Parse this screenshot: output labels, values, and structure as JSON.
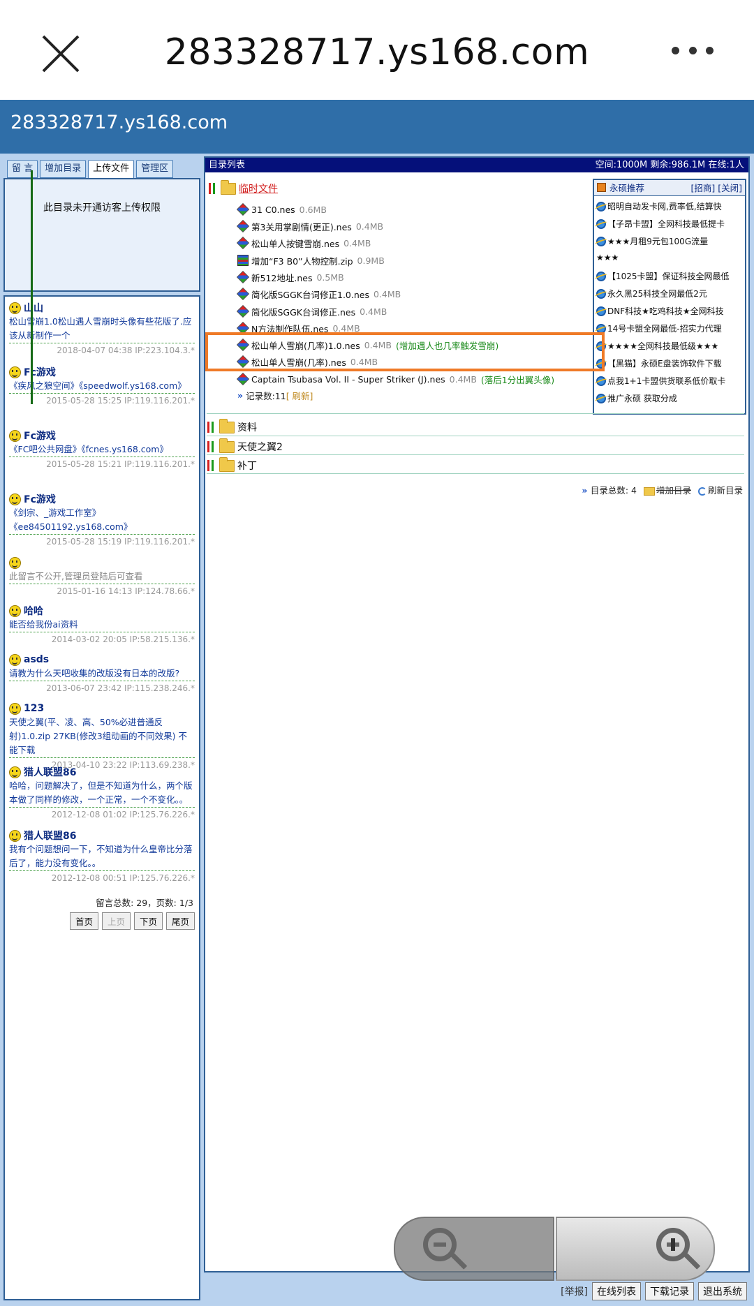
{
  "browser": {
    "title": "283328717.ys168.com"
  },
  "site": {
    "title": "283328717.ys168.com"
  },
  "tabs": [
    {
      "label": "留 言"
    },
    {
      "label": "增加目录"
    },
    {
      "label": "上传文件"
    },
    {
      "label": "管理区"
    }
  ],
  "upload_message": "此目录未开通访客上传权限",
  "comments": [
    {
      "name": "山山",
      "body": "松山雪崩1.0松山遇人雪崩时头像有些花版了.应该从新制作一个",
      "meta": "2018-04-07 04:38 IP:223.104.3.*"
    },
    {
      "name": "Fc游戏",
      "body": "《疾风之狼空间》《speedwolf.ys168.com》",
      "meta": "2015-05-28 15:25 IP:119.116.201.*"
    },
    {
      "name": "Fc游戏",
      "body": "《FC吧公共网盘》《fcnes.ys168.com》",
      "meta": "2015-05-28 15:21 IP:119.116.201.*"
    },
    {
      "name": "Fc游戏",
      "body": "《剑宗、_游戏工作室》《ee84501192.ys168.com》",
      "meta": "2015-05-28 15:19 IP:119.116.201.*"
    },
    {
      "name": "",
      "body": "此留言不公开,管理员登陆后可查看",
      "meta": "2015-01-16 14:13 IP:124.78.66.*"
    },
    {
      "name": "哈哈",
      "body": "能否给我份ai资料",
      "meta": "2014-03-02 20:05 IP:58.215.136.*"
    },
    {
      "name": "asds",
      "body": "请教为什么天吧收集的改版没有日本的改版?",
      "meta": "2013-06-07 23:42 IP:115.238.246.*"
    },
    {
      "name": "123",
      "body": "天使之翼(平、凌、高、50%必进普通反射)1.0.zip 27KB(修改3组动画的不同效果) 不能下载",
      "meta": "2013-04-10 23:22 IP:113.69.238.*"
    },
    {
      "name": "猎人联盟86",
      "body": "哈哈，问题解决了，但是不知道为什么，两个版本做了同样的修改，一个正常，一个不变化。。",
      "meta": "2012-12-08 01:02 IP:125.76.226.*"
    },
    {
      "name": "猎人联盟86",
      "body": "我有个问题想问一下，不知道为什么皇帝比分落后了，能力没有变化。。",
      "meta": "2012-12-08 00:51 IP:125.76.226.*"
    }
  ],
  "comment_total": "留言总数: 29，页数: 1/3",
  "pager": {
    "first": "首页",
    "prev": "上页",
    "next": "下页",
    "last": "尾页"
  },
  "panel": {
    "header_left": "目录列表",
    "header_right": "空间:1000M 剩余:986.1M 在线:1人"
  },
  "folders": [
    {
      "name": "临时文件"
    },
    {
      "name": "资料"
    },
    {
      "name": "天使之翼2"
    },
    {
      "name": "补丁"
    }
  ],
  "files": [
    {
      "name": "31 C0.nes",
      "size": "0.6MB",
      "note": "",
      "icon": "nes-icon"
    },
    {
      "name": "第3关用掌剧情(更正).nes",
      "size": "0.4MB",
      "note": "",
      "icon": "nes-icon"
    },
    {
      "name": "松山单人按键雪崩.nes",
      "size": "0.4MB",
      "note": "",
      "icon": "nes-icon"
    },
    {
      "name": "增加“F3 B0”人物控制.zip",
      "size": "0.9MB",
      "note": "",
      "icon": "zip-icon"
    },
    {
      "name": "新512地址.nes",
      "size": "0.5MB",
      "note": "",
      "icon": "nes-icon"
    },
    {
      "name": "简化版SGGK台词修正1.0.nes",
      "size": "0.4MB",
      "note": "",
      "icon": "nes-icon"
    },
    {
      "name": "简化版SGGK台词修正.nes",
      "size": "0.4MB",
      "note": "",
      "icon": "nes-icon"
    },
    {
      "name": "N方法制作队伍.nes",
      "size": "0.4MB",
      "note": "",
      "icon": "nes-icon"
    },
    {
      "name": "松山单人雪崩(几率)1.0.nes",
      "size": "0.4MB",
      "note": "(增加遇人也几率触发雪崩)",
      "icon": "nes-icon"
    },
    {
      "name": "松山单人雪崩(几率).nes",
      "size": "0.4MB",
      "note": "",
      "icon": "nes-icon"
    },
    {
      "name": "Captain Tsubasa Vol. II - Super Striker (J).nes",
      "size": "0.4MB",
      "note": "(落后1分出翼头像)",
      "icon": "nes-icon"
    }
  ],
  "record_count": "记录数:11",
  "refresh_link": "[ 刷新]",
  "recommend": {
    "title": "永硕推荐",
    "actions": "[招商] [关闭]",
    "items": [
      "昭明自动发卡网,费率低,结算快",
      "【子昂卡盟】全网科技最低提卡",
      "★★★月租9元包100G流量",
      "★★★",
      "【1025卡盟】保证科技全网最低",
      "永久黑25科技全网最低2元",
      "DNF科技★吃鸡科技★全网科技",
      "14号卡盟全网最低-招实力代理",
      "★★★★全网科技最低级★★★",
      "【黑猫】永硕E盘装饰软件下载",
      "点我1+1卡盟供货联系低价取卡",
      "推广永硕 获取分成"
    ]
  },
  "footer": {
    "total": "目录总数: 4",
    "add_folder": "增加目录",
    "refresh_folder": "刷新目录"
  },
  "bottom": {
    "report": "[举报]",
    "online_list": "在线列表",
    "download_log": "下载记录",
    "logout": "退出系统"
  }
}
